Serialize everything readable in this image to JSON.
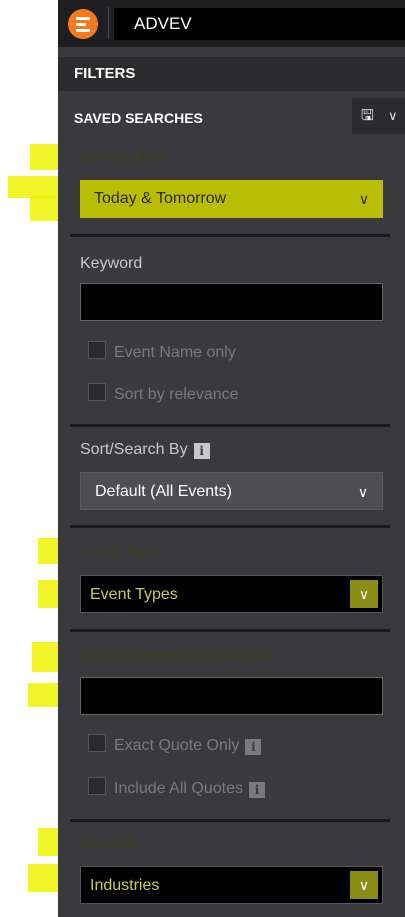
{
  "app": {
    "tab_title": "ADVEV"
  },
  "filters": {
    "title": "FILTERS"
  },
  "saved_searches": {
    "label": "SAVED SEARCHES",
    "save_icon": "save-icon"
  },
  "events_date": {
    "label": "Events Date",
    "selected": "Today & Tomorrow"
  },
  "keyword": {
    "label": "Keyword",
    "value": "",
    "event_name_only": "Event Name only",
    "sort_by_relevance": "Sort by relevance"
  },
  "sort_search": {
    "label": "Sort/Search By",
    "selected": "Default (All Events)"
  },
  "event_type": {
    "label": "Event Type",
    "selected": "Event Types"
  },
  "ric": {
    "label": "RIC/Company/Portfolio/List",
    "value": "",
    "exact_quote_only": "Exact Quote Only",
    "include_all_quotes": "Include All Quotes"
  },
  "industry": {
    "label": "Industry",
    "selected": "Industries"
  },
  "colors": {
    "panel": "#3a3a3e",
    "topbar": "#1f1f22",
    "logo": "#f47a20",
    "highlight": "#eef200"
  }
}
